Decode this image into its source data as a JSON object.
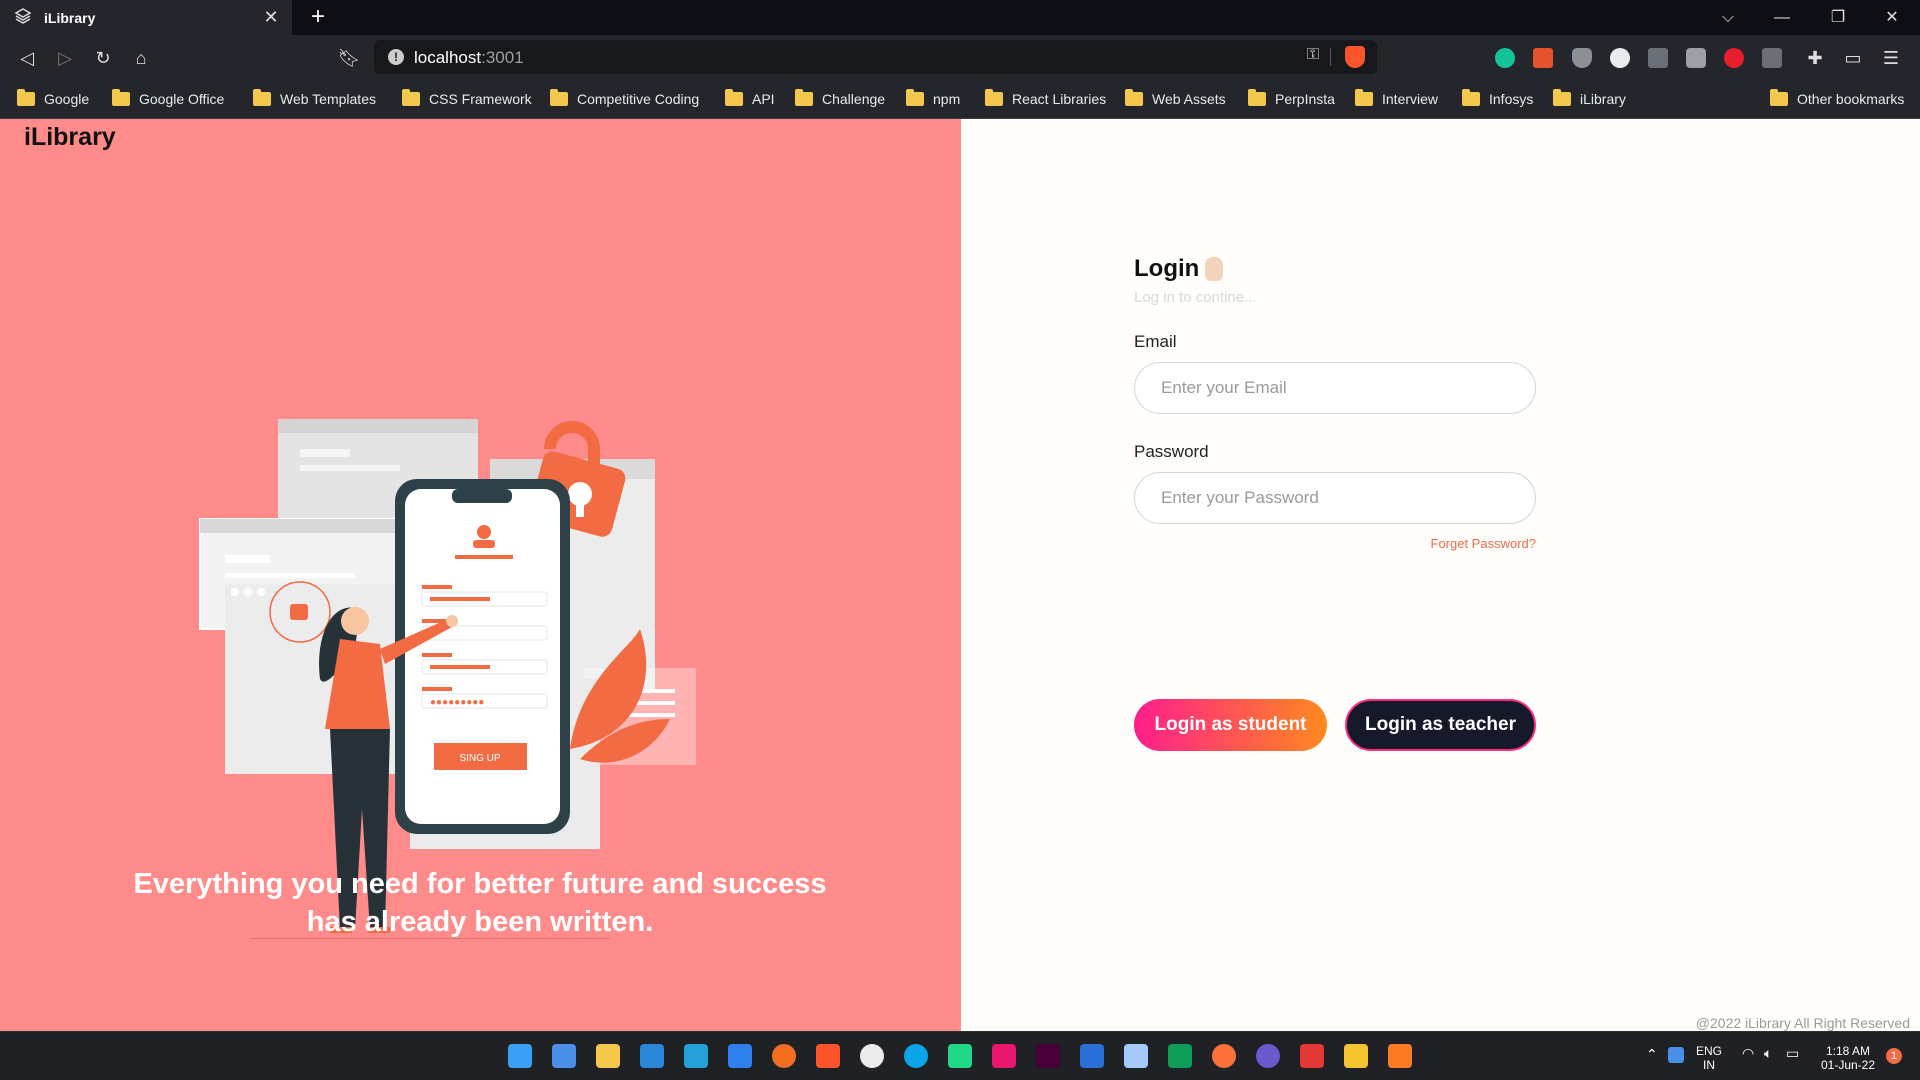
{
  "browser": {
    "tab_title": "iLibrary",
    "url_host": "localhost",
    "url_port": ":3001",
    "bookmarks": [
      "Google",
      "Google Office",
      "Web Templates",
      "CSS Framework",
      "Competitive Coding",
      "API",
      "Challenge",
      "npm",
      "React Libraries",
      "Web Assets",
      "PerpInsta",
      "Interview",
      "Infosys",
      "iLibrary"
    ],
    "other_bookmarks": "Other bookmarks"
  },
  "app": {
    "logo": "iLibrary",
    "tagline_1": "Everything you need for better future and success",
    "tagline_2": "has already been written.",
    "illustration_button": "SING UP"
  },
  "login": {
    "title": "Login",
    "subtitle": "Log in to contine...",
    "email_label": "Email",
    "email_placeholder": "Enter your Email",
    "password_label": "Password",
    "password_placeholder": "Enter your Password",
    "forget": "Forget Password?",
    "student_button": "Login as student",
    "teacher_button": "Login as teacher"
  },
  "footer": "@2022 iLibrary All Right Reserved",
  "taskbar": {
    "lang_1": "ENG",
    "lang_2": "IN",
    "time": "1:18 AM",
    "date": "01-Jun-22",
    "notif_count": "1"
  },
  "colors": {
    "left_panel": "#ff8b8b",
    "accent_orange": "#f26b43",
    "student_gradient": [
      "#ff1e8c",
      "#ff8a1e"
    ],
    "teacher_bg": "#15192a"
  }
}
